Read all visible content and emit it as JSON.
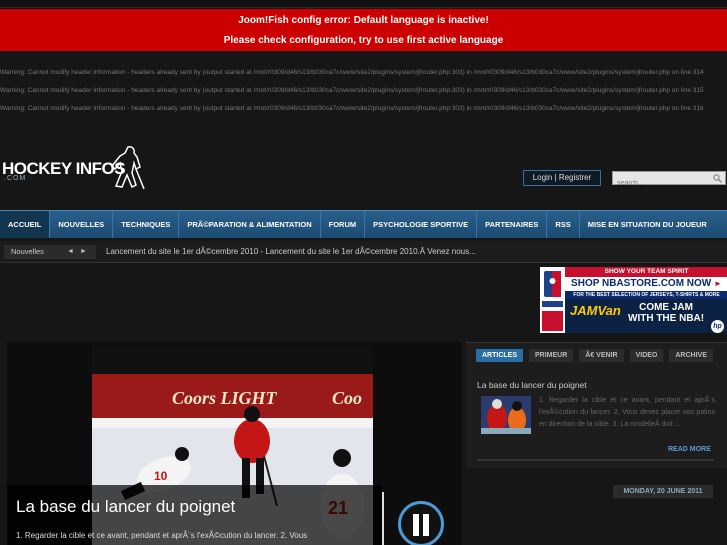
{
  "errors": {
    "line1": "Joom!Fish config error: Default language is inactive!",
    "line2": "Please check configuration, try to use first active language"
  },
  "warnings": [
    "Warning: Cannot modify header information - headers already sent by (output started at /mnt/r0309/d46/s13/b030ca7c/www/site2/plugins/system/jfrouter.php:303) in /mnt/r0309/d46/s13/b030ca7c/www/site2/plugins/system/jfrouter.php on line 314",
    "Warning: Cannot modify header information - headers already sent by (output started at /mnt/r0309/d46/s13/b030ca7c/www/site2/plugins/system/jfrouter.php:303) in /mnt/r0309/d46/s13/b030ca7c/www/site2/plugins/system/jfrouter.php on line 315",
    "Warning: Cannot modify header information - headers already sent by (output started at /mnt/r0309/d46/s13/b030ca7c/www/site2/plugins/system/jfrouter.php:303) in /mnt/r0309/d46/s13/b030ca7c/www/site2/plugins/system/jfrouter.php on line 316"
  ],
  "header": {
    "logo_text": "HOCKEY INFOS",
    "logo_sub": ".COM",
    "login": "Login",
    "register": "Registrer",
    "search_placeholder": "search..."
  },
  "nav": {
    "items": [
      "ACCUEIL",
      "NOUVELLES",
      "TECHNIQUES",
      "PRÃ©PARATION & ALIMENTATION",
      "FORUM",
      "PSYCHOLOGIE SPORTIVE",
      "PARTENAIRES",
      "RSS",
      "MISE EN SITUATION DU JOUEUR"
    ],
    "active": "ACCUEIL"
  },
  "ticker": {
    "label": "Nouvelles",
    "prev": "◄",
    "next": "►",
    "text": "Lancement du site le 1er dÃ©cembre 2010 - Lancement du site le 1er dÃ©cembre 2010.Â Venez nous...",
    "date": "MONDAY, 20 JUNE 2011"
  },
  "ad": {
    "spirit": "SHOW YOUR TEAM SPIRIT",
    "shop": "SHOP NBASTORE.COM NOW",
    "shop_arrow": "►",
    "best": "FOR THE BEST SELECTION OF JERSEYS, T-SHIRTS & MORE",
    "jam": "JAMVan",
    "come1": "COME JAM",
    "come2": "WITH THE NBA!",
    "hp": "hp"
  },
  "featured": {
    "title": "La base du lancer du poignet",
    "text": "1. Regarder la cible et ce avant, pendant et aprÃ¨s l'exÃ©cution du lancer. 2. Vous",
    "board_text": "Coors LIGHT",
    "board_text2": "Coo",
    "jersey_number": "21",
    "jersey_number2": "10"
  },
  "tabs": {
    "items": [
      "ARTICLES",
      "PRIMEUR",
      "Ã€ VENIR",
      "VIDEO",
      "ARCHIVE"
    ],
    "active": "ARTICLES"
  },
  "article": {
    "title": "La base du lancer du poignet",
    "text": "1. Regarder la cible et ce avant, pendant et aprÃ¨s l'exÃ©cution du lancer. 2. Vous devez placer vos patins en direction de la cible. 3. La rondelleÂ doit ...",
    "read_more": "READ MORE"
  },
  "colors": {
    "error_bg": "#cc0000",
    "nav_blue": "#2a5f8c",
    "accent": "#4a9ad6"
  }
}
